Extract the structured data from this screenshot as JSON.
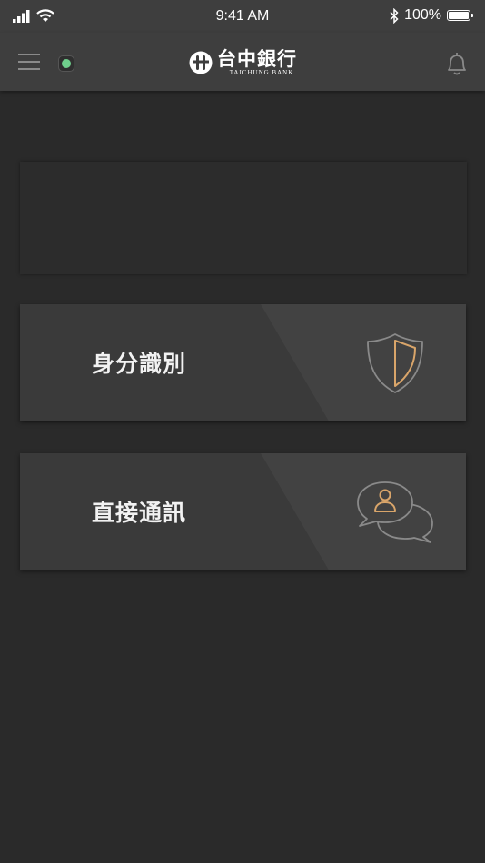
{
  "status_bar": {
    "time": "9:41 AM",
    "battery": "100%"
  },
  "nav": {
    "logo_cn": "台中銀行",
    "logo_en": "TAICHUNG BANK",
    "status_color": "#6fd08c"
  },
  "cards": [
    {
      "label": "身分識別",
      "icon": "shield-icon"
    },
    {
      "label": "直接通訊",
      "icon": "chat-user-icon"
    }
  ],
  "colors": {
    "background": "#2a2a2a",
    "header": "#3e3e3e",
    "card": "#3a3a3a",
    "accent": "#d9a56a"
  }
}
